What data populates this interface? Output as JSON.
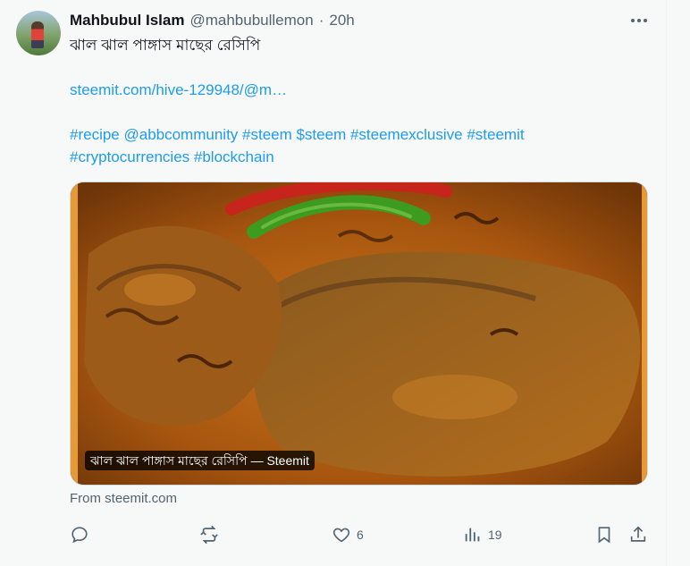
{
  "author": {
    "name": "Mahbubul Islam",
    "handle": "@mahbubullemon",
    "separator": "·",
    "time": "20h"
  },
  "tweet": {
    "title": "ঝাল ঝাল পাঙ্গাস মাছের রেসিপি",
    "link": "steemit.com/hive-129948/@m…",
    "hashtags_line1": "#recipe @abbcommunity #steem $steem #steemexclusive #steemit",
    "hashtags_line2": "#cryptocurrencies #blockchain"
  },
  "card": {
    "label": "ঝাল ঝাল পাঙ্গাস মাছের রেসিপি — Steemit",
    "source": "From steemit.com",
    "image_desc": "fish-curry-photo"
  },
  "actions": {
    "reply_count": "",
    "repost_count": "",
    "like_count": "6",
    "views_count": "19"
  },
  "colors": {
    "link": "#1d9bf0",
    "secondary_text": "#536471",
    "background": "#f7f9f9"
  }
}
